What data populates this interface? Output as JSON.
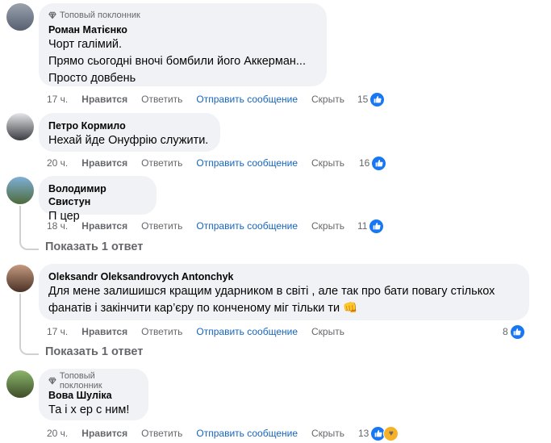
{
  "comments": [
    {
      "badge": "Топовый поклонник",
      "author": "Роман Матієнко",
      "lines": [
        "Чорт галімий.",
        "Прямо сьогодні вночі бомбили його Аккерман...",
        "Просто довбень"
      ],
      "time": "17 ч.",
      "like": "Нравится",
      "reply": "Ответить",
      "message": "Отправить сообщение",
      "hide": "Скрыть",
      "count": "15"
    },
    {
      "author": "Петро Кормило",
      "lines": [
        "Нехай йде Онуфрію служити."
      ],
      "time": "20 ч.",
      "like": "Нравится",
      "reply": "Ответить",
      "message": "Отправить сообщение",
      "hide": "Скрыть",
      "count": "16"
    },
    {
      "author": "Володимир Свистун",
      "lines": [
        "П  цер"
      ],
      "time": "18 ч.",
      "like": "Нравится",
      "reply": "Ответить",
      "message": "Отправить сообщение",
      "hide": "Скрыть",
      "count": "11",
      "replies": "Показать 1 ответ"
    },
    {
      "author": "Oleksandr Oleksandrovych Antonchyk",
      "lines": [
        "Для мене залишишся кращим ударником в світі , але так про  бати повагу стількох",
        "фанатів і закінчити кар’єру по конченому міг тільки ти 👊"
      ],
      "time": "17 ч.",
      "like": "Нравится",
      "reply": "Ответить",
      "message": "Отправить сообщение",
      "hide": "Скрыть",
      "count": "8",
      "replies": "Показать 1 ответ"
    },
    {
      "badge": "Топовый поклонник",
      "author": "Вова Шуліка",
      "lines": [
        "Та і х  ер с ним!"
      ],
      "time": "20 ч.",
      "like": "Нравится",
      "reply": "Ответить",
      "message": "Отправить сообщение",
      "hide": "Скрыть",
      "count": "13"
    }
  ],
  "colors": {
    "link": "#1665c0",
    "like": "#1877f2",
    "bubble": "#f0f2f5",
    "muted": "#65676b"
  },
  "icons": {
    "badge": "diamond-icon",
    "like": "thumbs-up-icon",
    "care": "care-emoji-icon"
  }
}
